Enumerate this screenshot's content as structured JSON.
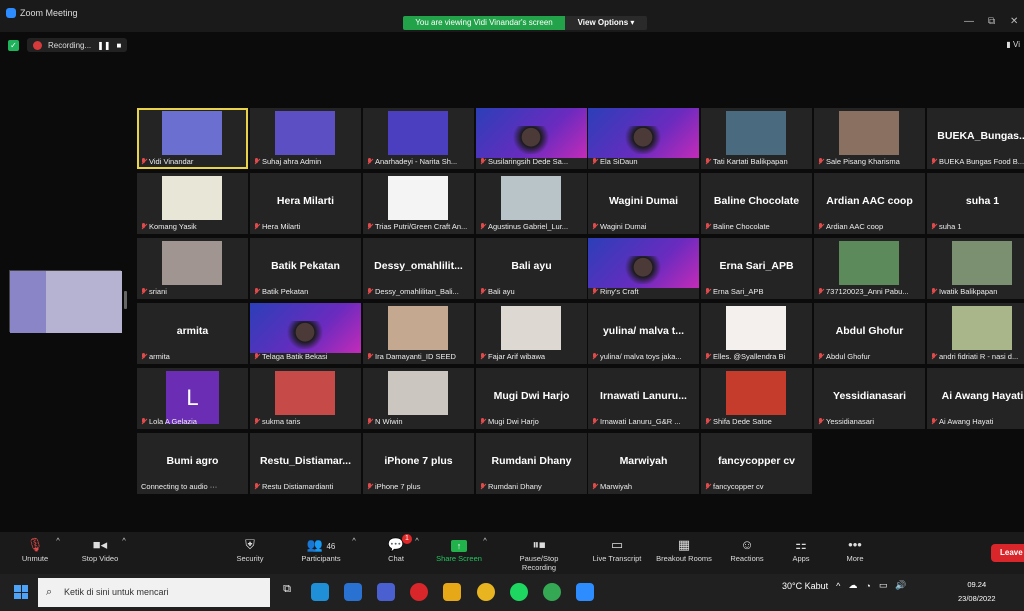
{
  "window": {
    "title": "Zoom Meeting",
    "minimize": "—",
    "restore": "⧉"
  },
  "banner": {
    "viewing": "You are viewing Vidi Vinandar's screen",
    "view_options": "View Options ▾"
  },
  "recording": {
    "label": "Recording..."
  },
  "top_right": {
    "view_label": "Vi"
  },
  "tiles": [
    {
      "label": "Vidi Vinandar",
      "type": "photo",
      "active": true,
      "bg": "#6a6fd0"
    },
    {
      "label": "Suhaj ahra Admin",
      "type": "photo",
      "bg": "#5c4fc4"
    },
    {
      "label": "Anarhadeyi - Narita Sh...",
      "type": "photo",
      "bg": "#4b3fbf"
    },
    {
      "label": "Susilaringsih Dede Sa...",
      "type": "slide"
    },
    {
      "label": "Ela SiDaun",
      "type": "slide"
    },
    {
      "label": "Tati Kartati Balikpapan",
      "type": "photo",
      "bg": "#4a6a80"
    },
    {
      "label": "Sale Pisang Kharisma",
      "type": "photo",
      "bg": "#8a7060"
    },
    {
      "label": "BUEKA Bungas Food B...",
      "type": "name",
      "big": "BUEKA_Bungas..."
    },
    {
      "label": "Komang Yasik",
      "type": "photo",
      "bg": "#e8e6d6"
    },
    {
      "label": "Hera Milarti",
      "type": "name",
      "big": "Hera Milarti"
    },
    {
      "label": "Trias Putri/Green Craft An...",
      "type": "photo",
      "bg": "#f4f4f4"
    },
    {
      "label": "Agustinus Gabriel_Lur...",
      "type": "photo",
      "bg": "#b8c4c8"
    },
    {
      "label": "Wagini Dumai",
      "type": "name",
      "big": "Wagini Dumai"
    },
    {
      "label": "Baline Chocolate",
      "type": "name",
      "big": "Baline Chocolate"
    },
    {
      "label": "Ardian AAC coop",
      "type": "name",
      "big": "Ardian AAC coop"
    },
    {
      "label": "suha 1",
      "type": "name",
      "big": "suha 1"
    },
    {
      "label": "sriani",
      "type": "photo",
      "bg": "#a09590"
    },
    {
      "label": "Batik Pekatan",
      "type": "name",
      "big": "Batik Pekatan"
    },
    {
      "label": "Dessy_omahlilitan_Bali...",
      "type": "name",
      "big": "Dessy_omahlilit..."
    },
    {
      "label": "Bali ayu",
      "type": "name",
      "big": "Bali ayu"
    },
    {
      "label": "Riny's Craft",
      "type": "slide"
    },
    {
      "label": "Erna Sari_APB",
      "type": "name",
      "big": "Erna Sari_APB"
    },
    {
      "label": "737120023_Anni Pabu...",
      "type": "photo",
      "bg": "#5d8a5a"
    },
    {
      "label": "Iwatik Balikpapan",
      "type": "photo",
      "bg": "#7a9070"
    },
    {
      "label": "armita",
      "type": "name",
      "big": "armita"
    },
    {
      "label": "Telaga Batik Bekasi",
      "type": "slide"
    },
    {
      "label": "Ira Damayanti_ID SEED",
      "type": "photo",
      "bg": "#c4a890"
    },
    {
      "label": "Fajar Arif wibawa",
      "type": "photo",
      "bg": "#ddd8d2"
    },
    {
      "label": "yulina/ malva toys jaka...",
      "type": "name",
      "big": "yulina/ malva t..."
    },
    {
      "label": "Elles. @Syallendra Bi",
      "type": "photo",
      "bg": "#f4f0ee"
    },
    {
      "label": "Abdul Ghofur",
      "type": "name",
      "big": "Abdul Ghofur"
    },
    {
      "label": "andri fidriati R - nasi d...",
      "type": "photo",
      "bg": "#a9b68a"
    },
    {
      "label": "Lola A Gelazia",
      "type": "avatar",
      "letter": "L"
    },
    {
      "label": "sukma taris",
      "type": "photo",
      "bg": "#c64a48"
    },
    {
      "label": "N Wiwin",
      "type": "photo",
      "bg": "#cbc6c0"
    },
    {
      "label": "Mugi Dwi Harjo",
      "type": "name",
      "big": "Mugi Dwi Harjo"
    },
    {
      "label": "Irnawati Lanuru_G&R ...",
      "type": "name",
      "big": "Irnawati Lanuru..."
    },
    {
      "label": "Shifa Dede Satoe",
      "type": "photo",
      "bg": "#c63c2c"
    },
    {
      "label": "Yessidianasari",
      "type": "name",
      "big": "Yessidianasari"
    },
    {
      "label": "Ai Awang Hayati",
      "type": "name",
      "big": "Ai Awang Hayati"
    },
    {
      "label": "Connecting to audio ···",
      "type": "name",
      "big": "Bumi agro",
      "nomute": true
    },
    {
      "label": "Restu Distiamardianti",
      "type": "name",
      "big": "Restu_Distiamar..."
    },
    {
      "label": "iPhone 7 plus",
      "type": "name",
      "big": "iPhone 7 plus"
    },
    {
      "label": "Rumdani Dhany",
      "type": "name",
      "big": "Rumdani Dhany"
    },
    {
      "label": "Marwiyah",
      "type": "name",
      "big": "Marwiyah"
    },
    {
      "label": "fancycopper cv",
      "type": "name",
      "big": "fancycopper cv"
    }
  ],
  "toolbar": {
    "unmute": "Unmute",
    "stop_video": "Stop Video",
    "security": "Security",
    "participants": "Participants",
    "participants_count": "46",
    "chat": "Chat",
    "chat_badge": "1",
    "share_screen": "Share Screen",
    "pause_stop_recording": "Pause/Stop Recording",
    "live_transcript": "Live Transcript",
    "breakout_rooms": "Breakout Rooms",
    "reactions": "Reactions",
    "apps": "Apps",
    "more": "More",
    "leave": "Leave"
  },
  "taskbar": {
    "search_placeholder": "Ketik di sini untuk mencari",
    "weather": "30°C  Kabut",
    "time": "09.24",
    "date": "23/08/2022"
  }
}
